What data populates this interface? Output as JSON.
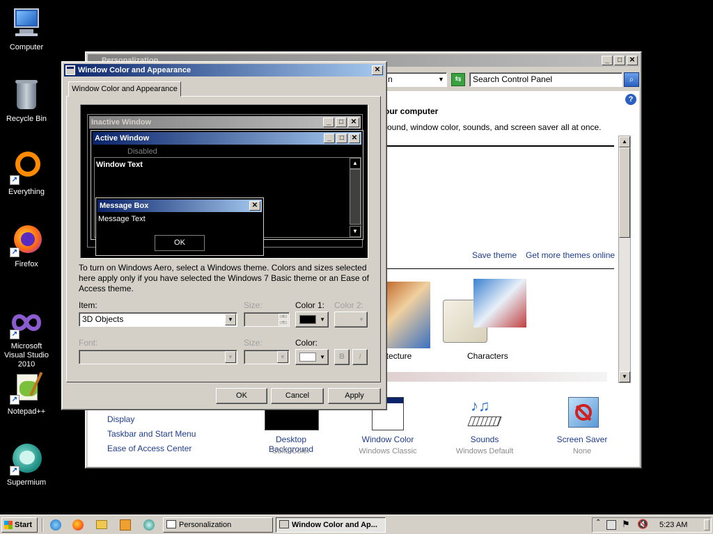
{
  "desktop": {
    "icons": [
      {
        "label": "Computer"
      },
      {
        "label": "Recycle Bin"
      },
      {
        "label": "Everything"
      },
      {
        "label": "Firefox"
      },
      {
        "label": "Microsoft Visual Studio 2010"
      },
      {
        "label": "Notepad++"
      },
      {
        "label": "Supermium"
      }
    ]
  },
  "personalization": {
    "title": "Personalization",
    "address_tail": "n",
    "search_placeholder": "Search Control Panel",
    "heading": "our computer",
    "subheading": "round, window color, sounds, and screen saver all at once.",
    "save_theme": "Save theme",
    "get_more_themes": "Get more themes online",
    "themes": [
      {
        "label": "itecture"
      },
      {
        "label": "Characters"
      }
    ],
    "see_also": [
      "Display",
      "Taskbar and Start Menu",
      "Ease of Access Center"
    ],
    "bottom_items": [
      {
        "label": "Desktop Background",
        "value": "Solid Color"
      },
      {
        "label": "Window Color",
        "value": "Windows Classic"
      },
      {
        "label": "Sounds",
        "value": "Windows Default"
      },
      {
        "label": "Screen Saver",
        "value": "None"
      }
    ]
  },
  "dialog": {
    "title": "Window Color and Appearance",
    "tab": "Window Color and Appearance",
    "preview": {
      "inactive_title": "Inactive Window",
      "active_title": "Active Window",
      "disabled_text": "Disabled",
      "window_text": "Window Text",
      "msgbox_title": "Message Box",
      "msgbox_text": "Message Text",
      "msgbox_ok": "OK"
    },
    "info_text": "To turn on Windows Aero, select a Windows theme.  Colors and sizes selected here apply only if you have selected the Windows 7 Basic theme or an Ease of Access theme.",
    "item_label": "Item:",
    "item_value": "3D Objects",
    "size_label": "Size:",
    "color1_label": "Color 1:",
    "color2_label": "Color 2:",
    "font_label": "Font:",
    "font_size_label": "Size:",
    "font_color_label": "Color:",
    "bold_label": "B",
    "italic_label": "I",
    "ok": "OK",
    "cancel": "Cancel",
    "apply": "Apply",
    "colors": {
      "color1": "#000000",
      "font_color": "#ffffff"
    }
  },
  "taskbar": {
    "start": "Start",
    "tasks": [
      "Personalization",
      "Window Color and Ap..."
    ],
    "clock": "5:23 AM"
  }
}
